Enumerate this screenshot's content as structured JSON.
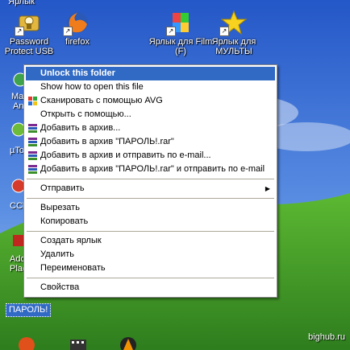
{
  "desktop": {
    "icons": [
      {
        "label": "Ярлык",
        "icon": "folder-icon"
      },
      {
        "label": "Password Protect USB",
        "icon": "password-protect-icon"
      },
      {
        "label": "firefox",
        "icon": "firefox-icon"
      },
      {
        "label": "Ярлык для Film (F)",
        "icon": "film-shortcut-icon"
      },
      {
        "label": "Ярлык для МУЛЬТЫ",
        "icon": "star-icon"
      },
      {
        "label": "Ma",
        "icon": "app-icon"
      },
      {
        "label": "An",
        "icon": ""
      },
      {
        "label": "µTo",
        "icon": "utorrent-icon"
      },
      {
        "label": "CCle",
        "icon": "ccleaner-icon"
      },
      {
        "label": "Ado",
        "icon": "adobe-icon"
      },
      {
        "label": "Plag",
        "icon": ""
      }
    ],
    "selected_folder": "ПАРОЛЬ!",
    "watermark": "bighub.ru"
  },
  "context_menu": {
    "items": [
      {
        "label": "Unlock this folder",
        "highlighted": true,
        "icon": ""
      },
      {
        "label": "Show how to open this file",
        "icon": ""
      },
      {
        "label": "Сканировать с помощью AVG",
        "icon": "avg-icon"
      },
      {
        "label": "Открыть с помощью...",
        "icon": ""
      },
      {
        "label": "Добавить в архив...",
        "icon": "winrar-icon"
      },
      {
        "label": "Добавить в архив \"ПАРОЛЬ!.rar\"",
        "icon": "winrar-icon"
      },
      {
        "label": "Добавить в архив и отправить по e-mail...",
        "icon": "winrar-icon"
      },
      {
        "label": "Добавить в архив \"ПАРОЛЬ!.rar\" и отправить по e-mail",
        "icon": "winrar-icon"
      },
      {
        "label": "Отправить",
        "submenu": true
      },
      {
        "label": "Вырезать"
      },
      {
        "label": "Копировать"
      },
      {
        "label": "Создать ярлык"
      },
      {
        "label": "Удалить"
      },
      {
        "label": "Переименовать"
      },
      {
        "label": "Свойства"
      }
    ]
  },
  "colors": {
    "menu_highlight": "#316ac5",
    "sky": "#3a6fd0",
    "grass": "#3f9a2a"
  }
}
